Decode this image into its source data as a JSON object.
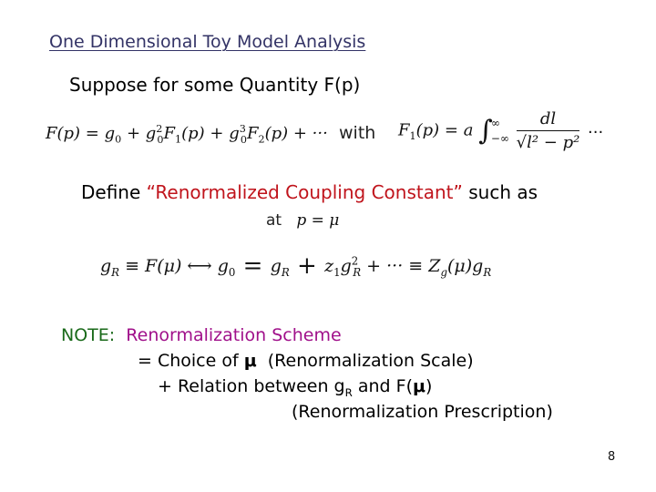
{
  "slide": {
    "title": "One Dimensional Toy Model Analysis",
    "suppose": "Suppose for some Quantity F(p)",
    "eq1": {
      "lhs": "F(p) = g",
      "g0_sub": "0",
      "plus1": " + g",
      "g0b_sub": "0",
      "g0b_sup": "2",
      "f1": "F",
      "f1_sub": "1",
      "f1_arg": "(p) + g",
      "g0c_sub": "0",
      "g0c_sup": "3",
      "f2": "F",
      "f2_sub": "2",
      "f2_arg": "(p) + ···"
    },
    "with_label": "with",
    "eq2": {
      "lhs": "F",
      "lhs_sub": "1",
      "lhs_rest": "(p) = a",
      "integral": "∫",
      "upper": "∞",
      "lower": "−∞",
      "numerator": "dl",
      "denominator": "√l² − p²"
    },
    "trailing_dots": "···",
    "define_prefix": "Define ",
    "define_highlight": "“Renormalized Coupling Constant”",
    "define_suffix": " such as",
    "at_word": "at",
    "at_condition": "p = μ",
    "eq3": {
      "part1": "g",
      "gR_sub": "R",
      "part2": " ≡ F(μ) ⟷ g",
      "g0_sub": "0",
      "equals": " = ",
      "part3": "g",
      "gR2_sub": "R",
      "plus": " + ",
      "z1": "z",
      "z1_sub": "1",
      "part4": "g",
      "gR3_sub": "R",
      "gR3_sup": "2",
      "part5": " + ··· ≡ Z",
      "zg_sub": "g",
      "part6": "(μ)g",
      "gR4_sub": "R"
    },
    "note_label": "NOTE:",
    "note_scheme": "Renormalization Scheme",
    "line2_prefix": "= Choice of ",
    "line2_mu": "μ",
    "line2_suffix": "  (Renormalization Scale)",
    "line3_prefix": "+ Relation between g",
    "line3_sub": "R",
    "line3_mid": " and F(",
    "line3_mu": "μ",
    "line3_end": ")",
    "line4": "(Renormalization Prescription)",
    "page_number": "8"
  },
  "colors": {
    "title": "#333366",
    "highlight_red": "#c0141c",
    "note_green": "#1a6a1a",
    "scheme_magenta": "#a0108a"
  }
}
